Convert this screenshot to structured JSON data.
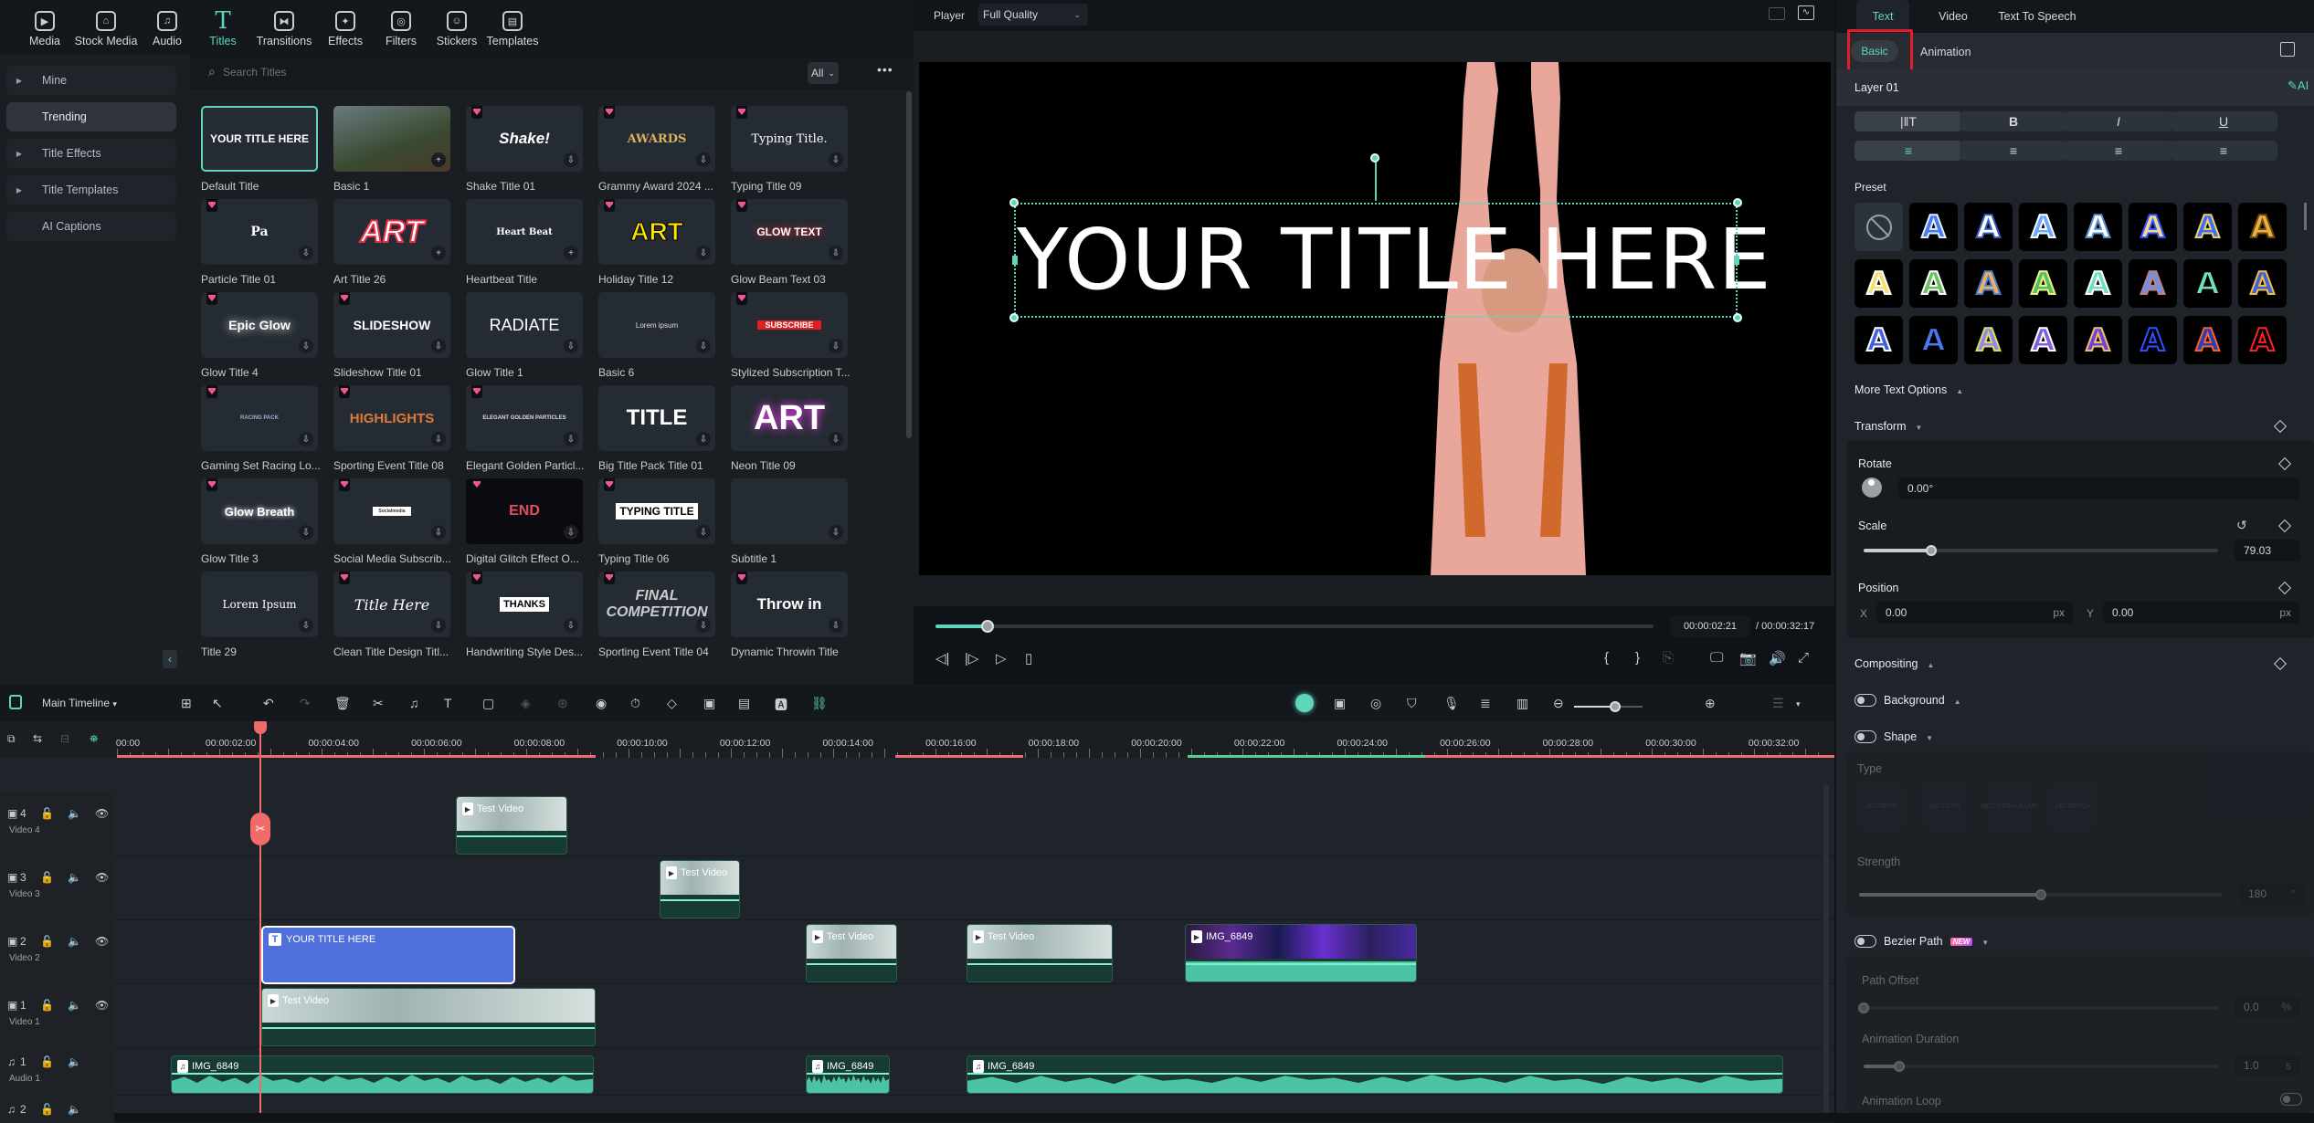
{
  "media_tabs": [
    {
      "label": "Media",
      "icon": "media-icon",
      "glyph": "▶"
    },
    {
      "label": "Stock Media",
      "icon": "stock-media-icon",
      "glyph": "⌂"
    },
    {
      "label": "Audio",
      "icon": "audio-icon",
      "glyph": "♫"
    },
    {
      "label": "Titles",
      "icon": "titles-icon",
      "glyph": "T",
      "active": true
    },
    {
      "label": "Transitions",
      "icon": "transitions-icon",
      "glyph": "⧓"
    },
    {
      "label": "Effects",
      "icon": "effects-icon",
      "glyph": "✦"
    },
    {
      "label": "Filters",
      "icon": "filters-icon",
      "glyph": "◎"
    },
    {
      "label": "Stickers",
      "icon": "stickers-icon",
      "glyph": "☺"
    },
    {
      "label": "Templates",
      "icon": "templates-icon",
      "glyph": "▤"
    }
  ],
  "categories": [
    {
      "label": "Mine",
      "expandable": true
    },
    {
      "label": "Trending",
      "expandable": false,
      "active": true
    },
    {
      "label": "Title Effects",
      "expandable": true
    },
    {
      "label": "Title Templates",
      "expandable": true
    },
    {
      "label": "AI Captions",
      "expandable": false
    }
  ],
  "search": {
    "placeholder": "Search Titles",
    "filter": "All",
    "filter_chevron": "⌄",
    "more": "•••"
  },
  "collapse_glyph": "‹",
  "titles": [
    {
      "name": "Default Title",
      "preview": "YOUR TITLE HERE",
      "premium": false,
      "action": "none",
      "selected": true
    },
    {
      "name": "Basic 1",
      "preview": "",
      "premium": false,
      "action": "add"
    },
    {
      "name": "Shake Title 01",
      "preview": "Shake!",
      "premium": true,
      "action": "download"
    },
    {
      "name": "Grammy Award 2024 ...",
      "preview": "AWARDS",
      "premium": true,
      "action": "download"
    },
    {
      "name": "Typing Title 09",
      "preview": "Typing Title.",
      "premium": true,
      "action": "download"
    },
    {
      "name": "Particle Title 01",
      "preview": "Pa",
      "premium": true,
      "action": "download"
    },
    {
      "name": "Art Title 26",
      "preview": "ART",
      "premium": false,
      "action": "add"
    },
    {
      "name": "Heartbeat Title",
      "preview": "Heart Beat",
      "premium": false,
      "action": "add"
    },
    {
      "name": "Holiday Title 12",
      "preview": "ART",
      "premium": true,
      "action": "download"
    },
    {
      "name": "Glow Beam Text 03",
      "preview": "GLOW TEXT",
      "premium": true,
      "action": "download"
    },
    {
      "name": "Glow Title 4",
      "preview": "Epic Glow",
      "premium": true,
      "action": "download"
    },
    {
      "name": "Slideshow Title 01",
      "preview": "SLIDESHOW",
      "premium": true,
      "action": "download"
    },
    {
      "name": "Glow Title 1",
      "preview": "RADIATE",
      "premium": false,
      "action": "download"
    },
    {
      "name": "Basic 6",
      "preview": "Lorem ipsum",
      "premium": false,
      "action": "download"
    },
    {
      "name": "Stylized Subscription T...",
      "preview": "SUBSCRIBE",
      "premium": true,
      "action": "download"
    },
    {
      "name": "Gaming Set Racing Lo...",
      "preview": "RACING PACK",
      "premium": true,
      "action": "download"
    },
    {
      "name": "Sporting Event Title 08",
      "preview": "HIGHLIGHTS",
      "premium": true,
      "action": "download"
    },
    {
      "name": "Elegant Golden Particl...",
      "preview": "ELEGANT GOLDEN PARTICLES",
      "premium": true,
      "action": "download"
    },
    {
      "name": "Big Title Pack Title 01",
      "preview": "TITLE",
      "premium": false,
      "action": "download"
    },
    {
      "name": "Neon Title 09",
      "preview": "ART",
      "premium": false,
      "action": "download"
    },
    {
      "name": "Glow Title 3",
      "preview": "Glow Breath",
      "premium": true,
      "action": "download"
    },
    {
      "name": "Social Media Subscrib...",
      "preview": "Socialmedia",
      "premium": true,
      "action": "download"
    },
    {
      "name": "Digital Glitch Effect O...",
      "preview": "END",
      "premium": true,
      "action": "download"
    },
    {
      "name": "Typing Title 06",
      "preview": "TYPING TITLE",
      "premium": true,
      "action": "download"
    },
    {
      "name": "Subtitle 1",
      "preview": "",
      "premium": false,
      "action": "download"
    },
    {
      "name": "Title 29",
      "preview": "Lorem Ipsum",
      "premium": false,
      "action": "download"
    },
    {
      "name": "Clean Title Design Titl...",
      "preview": "Title Here",
      "premium": true,
      "action": "download"
    },
    {
      "name": "Handwriting Style Des...",
      "preview": "THANKS",
      "premium": true,
      "action": "download"
    },
    {
      "name": "Sporting Event Title 04",
      "preview": "FINAL COMPETITION",
      "premium": true,
      "action": "download"
    },
    {
      "name": "Dynamic Throwin Title",
      "preview": "Throw in",
      "premium": true,
      "action": "download"
    }
  ],
  "player": {
    "label": "Player",
    "quality": "Full Quality",
    "quality_chevron": "⌄",
    "canvas_title": "YOUR TITLE HERE",
    "progress": 0.0727,
    "time_current": "00:00:02:21",
    "time_total": "/ 00:00:32:17",
    "controls": [
      {
        "name": "prev-frame-button",
        "glyph": "◁|"
      },
      {
        "name": "next-frame-button",
        "glyph": "|▷"
      },
      {
        "name": "play-button",
        "glyph": "▷"
      },
      {
        "name": "stop-button",
        "glyph": "▯"
      }
    ],
    "right_controls": [
      {
        "name": "mark-in-button",
        "glyph": "{"
      },
      {
        "name": "mark-out-button",
        "glyph": "}"
      },
      {
        "name": "insert-clip-button",
        "glyph": "⎘"
      },
      {
        "name": "display-settings-button",
        "glyph": "🖵"
      },
      {
        "name": "snapshot-button",
        "glyph": "📷"
      },
      {
        "name": "volume-button",
        "glyph": "🔊"
      },
      {
        "name": "fullscreen-button",
        "glyph": "⤢"
      }
    ]
  },
  "inspector": {
    "tabs": [
      "Text",
      "Video",
      "Text To Speech"
    ],
    "active_tab": "Text",
    "sub_tabs": [
      "Basic",
      "Animation"
    ],
    "layer": "Layer 01",
    "ai_edit": "✎AI",
    "format_buttons": [
      {
        "name": "text-spacing-button",
        "glyph": "|‖T"
      },
      {
        "name": "bold-button",
        "glyph": "B"
      },
      {
        "name": "italic-button",
        "glyph": "I"
      },
      {
        "name": "underline-button",
        "glyph": "U"
      }
    ],
    "align_buttons": [
      {
        "name": "align-left-button",
        "glyph": "≡",
        "active": true
      },
      {
        "name": "align-right-button",
        "glyph": "≡"
      },
      {
        "name": "align-center-button",
        "glyph": "≡"
      },
      {
        "name": "align-justify-button",
        "glyph": "≡"
      }
    ],
    "preset_label": "Preset",
    "presets": [
      {
        "fill": "none"
      },
      {
        "fill": "#4a78f0",
        "stroke": "#dfefff"
      },
      {
        "fill": "#ffffff",
        "stroke": "#3a5fc0"
      },
      {
        "fill": "#6aa8ff",
        "stroke": "#ffffff"
      },
      {
        "fill": "#ffffff",
        "stroke": "#5a90d0"
      },
      {
        "fill": "#f0d890",
        "stroke": "#3050ff"
      },
      {
        "fill": "#3a70ff",
        "stroke": "#f0d060"
      },
      {
        "fill": "#f0b040",
        "stroke": "#6a4a10"
      },
      {
        "fill": "#f8e070",
        "stroke": "#ffffff"
      },
      {
        "fill": "#6ac060",
        "stroke": "#ffffff"
      },
      {
        "fill": "#f0b060",
        "stroke": "#4a80d0"
      },
      {
        "fill": "#50c060",
        "stroke": "#f0f080"
      },
      {
        "fill": "#70e0c0",
        "stroke": "#ffffff"
      },
      {
        "fill": "#6a90f0",
        "stroke": "#c08080"
      },
      {
        "fill": "#70e0c0",
        "stroke": "#000000"
      },
      {
        "fill": "#4060e0",
        "stroke": "#f0c040"
      },
      {
        "fill": "#4060e0",
        "stroke": "#ffffff"
      },
      {
        "fill": "#4a78f0",
        "stroke": "#000000"
      },
      {
        "fill": "#a080f0",
        "stroke": "#d0e060"
      },
      {
        "fill": "#8060e0",
        "stroke": "#ffffff"
      },
      {
        "fill": "#7040e0",
        "stroke": "#f0c060"
      },
      {
        "fill": "#000000",
        "stroke": "#3050ff"
      },
      {
        "fill": "#2040c0",
        "stroke": "#ff6020"
      },
      {
        "fill": "#000000",
        "stroke": "#ff2020"
      }
    ],
    "more_text_options": "More Text Options",
    "transform": {
      "label": "Transform",
      "rotate_label": "Rotate",
      "rotate_value": "0.00°",
      "scale_label": "Scale",
      "scale_value": "79.03",
      "scale_fraction": 0.19,
      "position_label": "Position",
      "x_label": "X",
      "x_value": "0.00",
      "x_unit": "px",
      "y_label": "Y",
      "y_value": "0.00",
      "y_unit": "px"
    },
    "compositing_label": "Compositing",
    "background_label": "Background",
    "shape": {
      "label": "Shape",
      "type_label": "Type",
      "types": [
        "ABCDEFG",
        "ABCDEFG",
        "ABCDEFGHIJKLMN",
        "ABCDEFGH"
      ],
      "strength_label": "Strength",
      "strength_value": "180",
      "strength_unit": "°",
      "strength_fraction": 0.5
    },
    "bezier": {
      "label": "Bezier Path",
      "badge": "NEW",
      "path_offset_label": "Path Offset",
      "path_offset_value": "0.0",
      "path_offset_unit": "%",
      "path_offset_fraction": 0.0,
      "duration_label": "Animation Duration",
      "duration_value": "1.0",
      "duration_unit": "s",
      "duration_fraction": 0.1,
      "loop_label": "Animation Loop"
    }
  },
  "timeline": {
    "name": "Main Timeline",
    "name_chevron": "▾",
    "ruler": [
      "00:00",
      "00:00:02:00",
      "00:00:04:00",
      "00:00:06:00",
      "00:00:08:00",
      "00:00:10:00",
      "00:00:12:00",
      "00:00:14:00",
      "00:00:16:00",
      "00:00:18:00",
      "00:00:20:00",
      "00:00:22:00",
      "00:00:24:00",
      "00:00:26:00",
      "00:00:28:00",
      "00:00:30:00",
      "00:00:32:00"
    ],
    "tracks": [
      {
        "num": "4",
        "name": "Video 4",
        "type": "video"
      },
      {
        "num": "3",
        "name": "Video 3",
        "type": "video"
      },
      {
        "num": "2",
        "name": "Video 2",
        "type": "video"
      },
      {
        "num": "1",
        "name": "Video 1",
        "type": "video"
      },
      {
        "num": "1",
        "name": "Audio 1",
        "type": "audio"
      },
      {
        "num": "2",
        "name": "",
        "type": "audio"
      }
    ],
    "clips": {
      "video4": [
        {
          "label": "Test Video"
        }
      ],
      "video3": [
        {
          "label": "Test Video"
        }
      ],
      "video2": [
        {
          "label": "YOUR TITLE HERE",
          "kind": "title"
        },
        {
          "label": "Test Video"
        },
        {
          "label": "Test Video"
        },
        {
          "label": "IMG_6849"
        }
      ],
      "video1": [
        {
          "label": "Test Video"
        }
      ],
      "audio1": [
        {
          "label": "IMG_6849"
        },
        {
          "label": "IMG_6849"
        },
        {
          "label": "IMG_6849"
        }
      ]
    }
  }
}
